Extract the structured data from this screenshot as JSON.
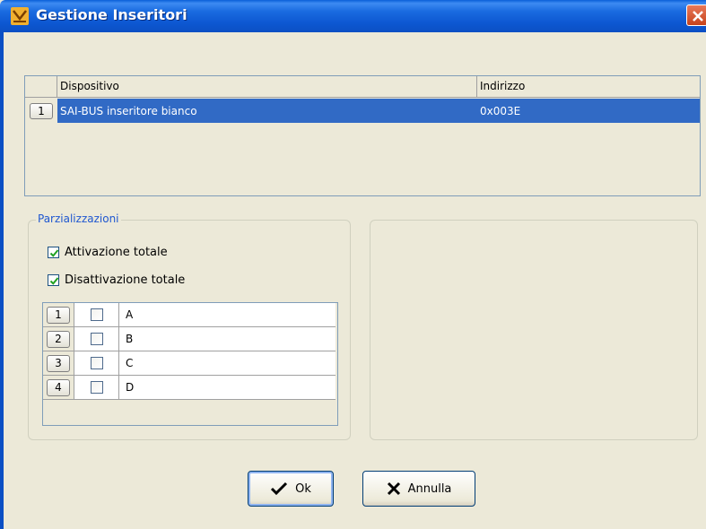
{
  "window": {
    "title": "Gestione Inseritori"
  },
  "devices": {
    "columns": [
      "Dispositivo",
      "Indirizzo"
    ],
    "rows": [
      {
        "num": "1",
        "device": "SAI-BUS inseritore bianco",
        "address": "0x003E",
        "selected": true
      }
    ]
  },
  "partitions": {
    "legend": "Parzializzazioni",
    "total_activation": {
      "label": "Attivazione totale",
      "checked": true
    },
    "total_deactivation": {
      "label": "Disattivazione totale",
      "checked": true
    },
    "rows": [
      {
        "num": "1",
        "checked": false,
        "label": "A"
      },
      {
        "num": "2",
        "checked": false,
        "label": "B"
      },
      {
        "num": "3",
        "checked": false,
        "label": "C"
      },
      {
        "num": "4",
        "checked": false,
        "label": "D"
      }
    ]
  },
  "buttons": {
    "ok": "Ok",
    "cancel": "Annulla"
  },
  "colors": {
    "titlebar": "#0b4fc4",
    "selection": "#316ac5",
    "legend": "#1f57d0",
    "check": "#21a121"
  }
}
